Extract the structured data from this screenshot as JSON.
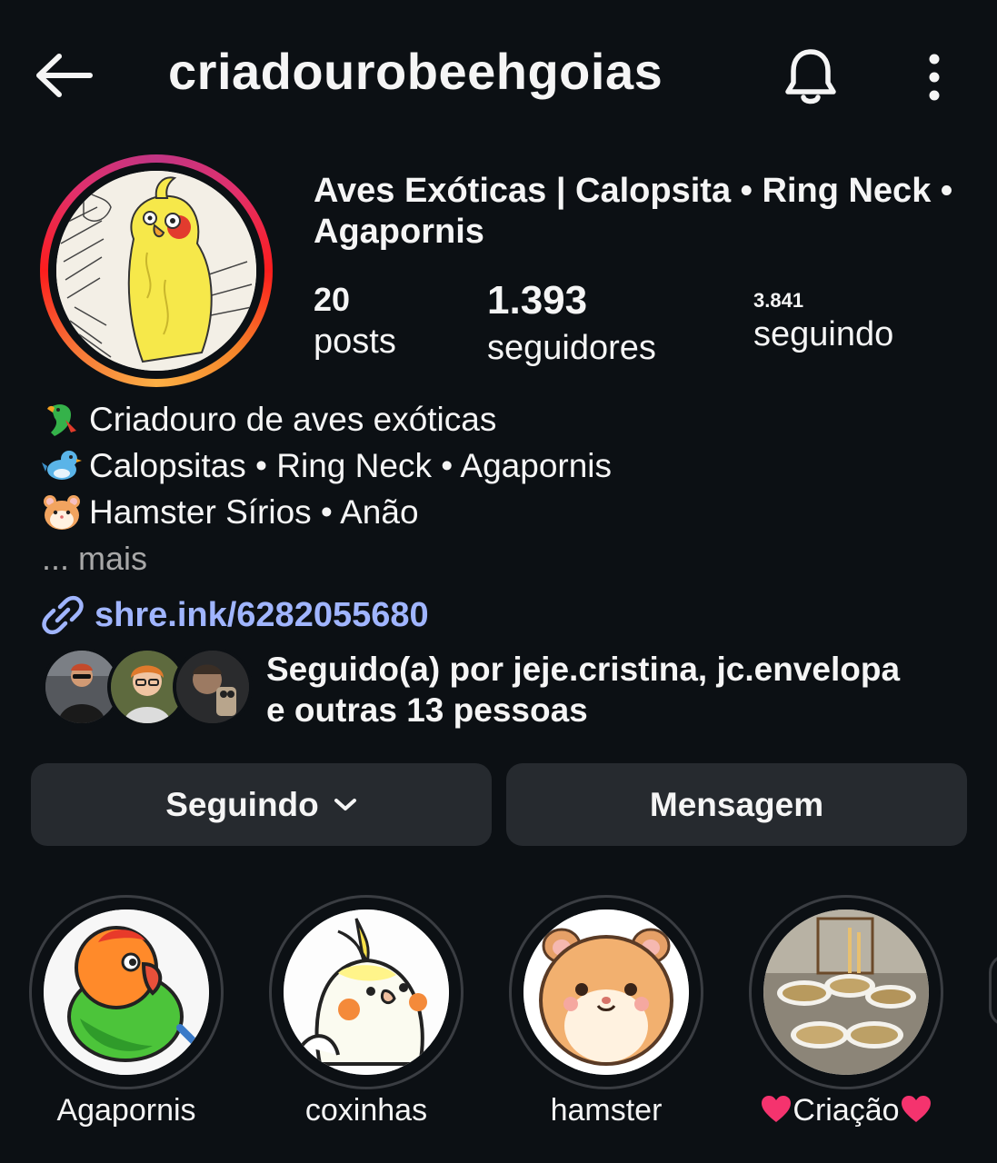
{
  "header": {
    "username": "criadourobeehgoias",
    "back_icon": "arrow-left-icon",
    "bell_icon": "bell-icon",
    "more_icon": "vertical-dots-icon"
  },
  "profile": {
    "display_name": "Aves Exóticas | Calopsita • Ring Neck • Agapornis",
    "stats": {
      "posts_count": "20",
      "posts_label": "posts",
      "followers_count": "1.393",
      "followers_label": "seguidores",
      "following_count": "3.841",
      "following_label": "seguindo"
    },
    "story_ring_colors": [
      "#fcaf45",
      "#f77737",
      "#e1306c",
      "#c13584"
    ]
  },
  "bio": {
    "lines": [
      {
        "icon": "parrot-emoji",
        "text": "Criadouro de aves exóticas"
      },
      {
        "icon": "bird-emoji",
        "text": "Calopsitas • Ring Neck • Agapornis"
      },
      {
        "icon": "hamster-emoji",
        "text": "Hamster Sírios • Anão"
      }
    ],
    "more": "... mais",
    "link": "shre.ink/6282055680",
    "link_color": "#a0b5ff"
  },
  "followed_by": {
    "line1": "Seguido(a) por jeje.cristina, jc.envelopa",
    "line2": "e outras 13 pessoas"
  },
  "actions": {
    "following_label": "Seguindo",
    "message_label": "Mensagem"
  },
  "highlights": [
    {
      "label": "Agapornis"
    },
    {
      "label": "coxinhas"
    },
    {
      "label": "hamster"
    },
    {
      "label": "Criação",
      "prefix_icon": "heart-emoji",
      "suffix_icon": "heart-emoji"
    }
  ]
}
